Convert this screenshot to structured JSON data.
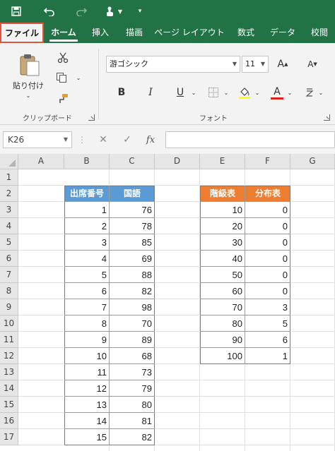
{
  "quick_access": {
    "save_icon": "save-icon",
    "undo_icon": "undo-icon",
    "redo_icon": "redo-icon",
    "touch_mode_icon": "touch-mode-icon",
    "customize_icon": "customize-qat-icon"
  },
  "tabs": [
    {
      "label": "ファイル",
      "state": "file"
    },
    {
      "label": "ホーム",
      "state": "active"
    },
    {
      "label": "挿入",
      "state": ""
    },
    {
      "label": "描画",
      "state": ""
    },
    {
      "label": "ページ レイアウト",
      "state": ""
    },
    {
      "label": "数式",
      "state": ""
    },
    {
      "label": "データ",
      "state": ""
    },
    {
      "label": "校閲",
      "state": ""
    }
  ],
  "ribbon": {
    "clipboard": {
      "paste_label": "貼り付け",
      "group_label": "クリップボード"
    },
    "font": {
      "font_name": "游ゴシック",
      "font_size": "11",
      "grow_label": "A",
      "shrink_label": "A",
      "bold_label": "B",
      "italic_label": "I",
      "underline_label": "U",
      "font_color_label": "A",
      "group_label": "フォント"
    },
    "colors": {
      "highlight": "#ffff00",
      "font_color": "#e0201b",
      "ribbon_green": "#217346"
    }
  },
  "formula_bar": {
    "name_box": "K26",
    "cancel_label": "✕",
    "enter_label": "✓",
    "fx_label": "fx",
    "value": ""
  },
  "grid": {
    "columns": [
      "A",
      "B",
      "C",
      "D",
      "E",
      "F",
      "G"
    ],
    "rows": [
      "1",
      "2",
      "3",
      "4",
      "5",
      "6",
      "7",
      "8",
      "9",
      "10",
      "11",
      "12",
      "13",
      "14",
      "15",
      "16",
      "17"
    ],
    "table1": {
      "header_color": "#5b9bd5",
      "headers": [
        "出席番号",
        "国語"
      ],
      "rows": [
        [
          "1",
          "76"
        ],
        [
          "2",
          "78"
        ],
        [
          "3",
          "85"
        ],
        [
          "4",
          "69"
        ],
        [
          "5",
          "88"
        ],
        [
          "6",
          "82"
        ],
        [
          "7",
          "98"
        ],
        [
          "8",
          "70"
        ],
        [
          "9",
          "89"
        ],
        [
          "10",
          "68"
        ],
        [
          "11",
          "73"
        ],
        [
          "12",
          "79"
        ],
        [
          "13",
          "80"
        ],
        [
          "14",
          "81"
        ],
        [
          "15",
          "82"
        ]
      ]
    },
    "table2": {
      "header_color": "#ed7d31",
      "headers": [
        "階級表",
        "分布表"
      ],
      "rows": [
        [
          "10",
          "0"
        ],
        [
          "20",
          "0"
        ],
        [
          "30",
          "0"
        ],
        [
          "40",
          "0"
        ],
        [
          "50",
          "0"
        ],
        [
          "60",
          "0"
        ],
        [
          "70",
          "3"
        ],
        [
          "80",
          "5"
        ],
        [
          "90",
          "6"
        ],
        [
          "100",
          "1"
        ]
      ]
    }
  }
}
